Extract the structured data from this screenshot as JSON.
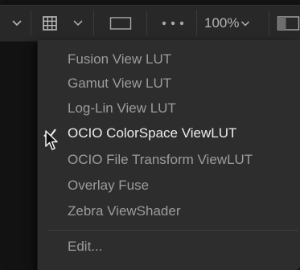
{
  "toolbar": {
    "zoom_label": "100%",
    "icons": [
      "chevron-down-icon",
      "grid-icon",
      "chevron-down-icon",
      "rectangle-icon",
      "more-icon",
      "chevron-down-icon",
      "split-view-icon"
    ]
  },
  "menu": {
    "items": [
      {
        "label": "Fusion View LUT"
      },
      {
        "label": "Gamut View LUT"
      },
      {
        "label": "Log-Lin View LUT"
      },
      {
        "label": "OCIO ColorSpace ViewLUT",
        "checked": true
      },
      {
        "label": "OCIO File Transform ViewLUT"
      },
      {
        "label": "Overlay Fuse"
      },
      {
        "label": "Zebra ViewShader"
      }
    ],
    "edit_label": "Edit..."
  },
  "colors": {
    "toolbar_bg": "#282828",
    "menu_bg": "#2d2d2d",
    "text_dim": "#9c9c9c",
    "text_active": "#ececec"
  }
}
